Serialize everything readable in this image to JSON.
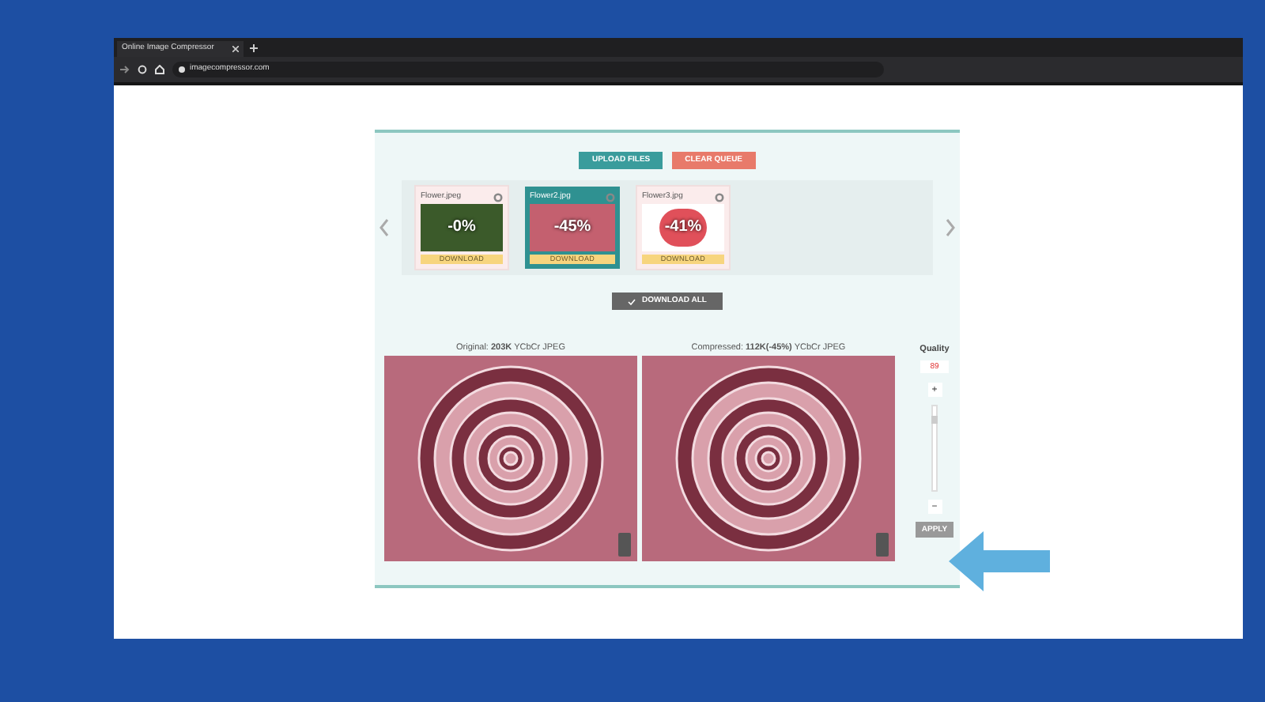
{
  "browser": {
    "tab_title": "Online Image Compressor",
    "address": "imagecompressor.com"
  },
  "actions": [
    {
      "kind": "upload",
      "label": "UPLOAD FILES"
    },
    {
      "kind": "clear",
      "label": "CLEAR QUEUE"
    }
  ],
  "files": [
    {
      "name": "Flower.jpeg",
      "badge": "-0%",
      "download": "DOWNLOAD",
      "selected": false
    },
    {
      "name": "Flower2.jpg",
      "badge": "-45%",
      "download": "DOWNLOAD",
      "selected": true
    },
    {
      "name": "Flower3.jpg",
      "badge": "-41%",
      "download": "DOWNLOAD",
      "selected": false
    }
  ],
  "download_all": "DOWNLOAD ALL",
  "original": {
    "label": "Original:",
    "size": "203K",
    "format": "YCbCr JPEG"
  },
  "compressed": {
    "label": "Compressed:",
    "size": "112K(-45%)",
    "format": "YCbCr JPEG"
  },
  "quality": {
    "label": "Quality",
    "value": "89",
    "plus": "+",
    "minus": "−",
    "level": 0.89,
    "apply": "APPLY"
  }
}
